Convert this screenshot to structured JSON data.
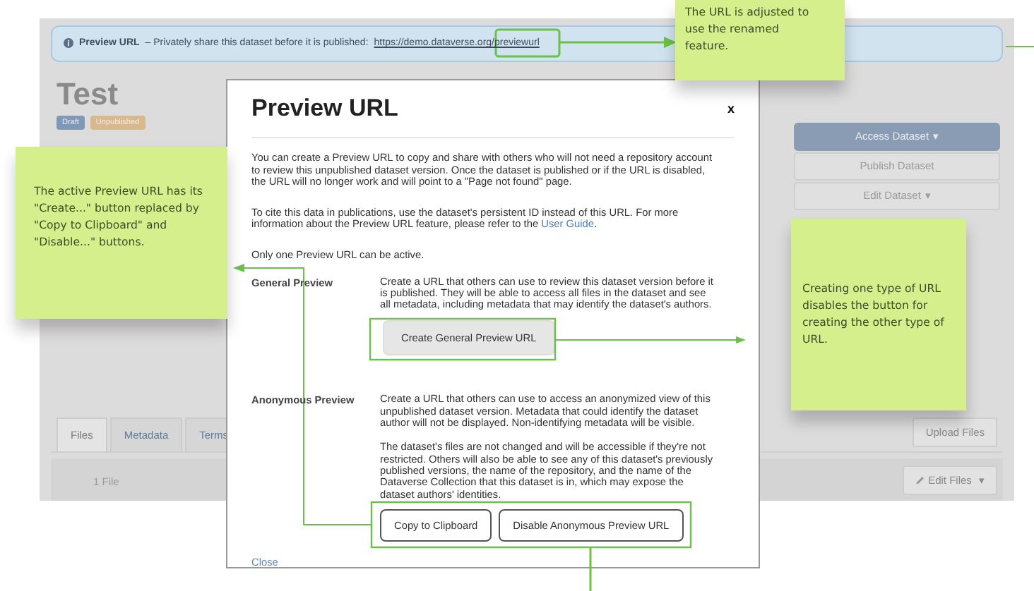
{
  "banner": {
    "title": "Preview URL",
    "text": "– Privately share this dataset before it is published:",
    "link": "https://demo.dataverse.org/previewurl"
  },
  "dataset": {
    "title": "Test",
    "badges": [
      {
        "label": "Draft",
        "color": "#7f98b6"
      },
      {
        "label": "Unpublished",
        "color": "#d9b88e"
      }
    ]
  },
  "actions": [
    {
      "label": "Access Dataset",
      "kind": "primary",
      "caret": "▾"
    },
    {
      "label": "Publish Dataset",
      "kind": "default"
    },
    {
      "label": "Edit Dataset",
      "kind": "default",
      "caret": "▾"
    }
  ],
  "tabs": [
    {
      "label": "Files",
      "selected": true
    },
    {
      "label": "Metadata",
      "selected": false
    },
    {
      "label": "Terms",
      "selected": false
    }
  ],
  "files": {
    "count": "1 File",
    "upload": "Upload Files",
    "edit": "Edit Files",
    "edit_caret": "▾"
  },
  "modal": {
    "title": "Preview URL",
    "close": "x",
    "intro": "You can create a Preview URL to copy and share with others who will not need a repository account to review this unpublished dataset version. Once the dataset is published or if the URL is disabled, the URL will no longer work and will point to a \"Page not found\" page.",
    "cite": "To cite this data in publications, use the dataset's persistent ID instead of this URL. For more information about the Preview URL feature, please refer to the",
    "cite_link": "User Guide",
    "cite_end": ".",
    "note": "Only one Preview URL can be active.",
    "sections": [
      {
        "label": "General Preview",
        "paragraphs": [
          "Create a URL that others can use to review this dataset version before it is published. They will be able to access all files in the dataset and see all metadata, including metadata that may identify the dataset's authors."
        ],
        "buttons": [
          {
            "label": "Create General Preview URL",
            "kind": "filled"
          }
        ]
      },
      {
        "label": "Anonymous Preview",
        "paragraphs": [
          "Create a URL that others can use to access an anonymized view of this unpublished dataset version. Metadata that could identify the dataset author will not be displayed. Non-identifying metadata will be visible.",
          "The dataset's files are not changed and will be accessible if they're not restricted. Others will also be able to see any of this dataset's previously published versions, the name of the repository, and the name of the Dataverse Collection that this dataset is in, which may expose the dataset authors' identities."
        ],
        "buttons": [
          {
            "label": "Copy to Clipboard",
            "kind": "outline"
          },
          {
            "label": "Disable Anonymous Preview URL",
            "kind": "outline"
          }
        ]
      }
    ],
    "footer": "Close"
  },
  "notes": [
    {
      "text": "The URL is adjusted to use the renamed feature.",
      "kind": "top"
    },
    {
      "text": "The active Preview URL has its \"Create...\" button replaced by  \"Copy to Clipboard\" and \"Disable...\" buttons.",
      "kind": "left"
    },
    {
      "text": "Creating one type of URL disables the button for creating the other type of URL.",
      "kind": "right"
    }
  ]
}
